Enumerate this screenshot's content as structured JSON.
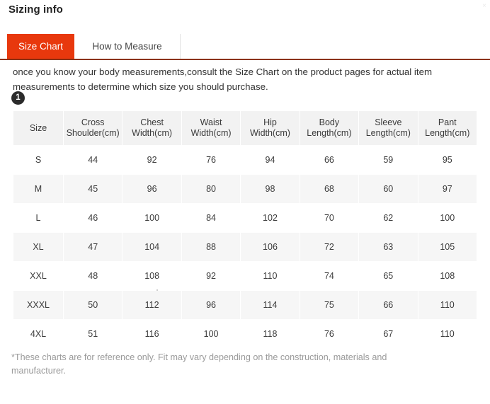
{
  "panel": {
    "title": "Sizing info",
    "close_icon_glyph": "×"
  },
  "tabs": [
    {
      "label": "Size Chart",
      "active": true
    },
    {
      "label": "How to Measure",
      "active": false
    }
  ],
  "intro": {
    "text": "once you know your body measurements,consult the Size Chart on the product pages for actual item measurements to determine which size you should purchase."
  },
  "step_badge": {
    "number": "1"
  },
  "chart_data": {
    "type": "table",
    "title": "Size Chart",
    "columns": [
      "Size",
      "Cross Shoulder(cm)",
      "Chest Width(cm)",
      "Waist Width(cm)",
      "Hip Width(cm)",
      "Body Length(cm)",
      "Sleeve Length(cm)",
      "Pant Length(cm)"
    ],
    "column_lines": [
      [
        "Size",
        ""
      ],
      [
        "Cross",
        "Shoulder(cm)"
      ],
      [
        "Chest",
        "Width(cm)"
      ],
      [
        "Waist",
        "Width(cm)"
      ],
      [
        "Hip",
        "Width(cm)"
      ],
      [
        "Body",
        "Length(cm)"
      ],
      [
        "Sleeve",
        "Length(cm)"
      ],
      [
        "Pant",
        "Length(cm)"
      ]
    ],
    "rows": [
      [
        "S",
        "44",
        "92",
        "76",
        "94",
        "66",
        "59",
        "95"
      ],
      [
        "M",
        "45",
        "96",
        "80",
        "98",
        "68",
        "60",
        "97"
      ],
      [
        "L",
        "46",
        "100",
        "84",
        "102",
        "70",
        "62",
        "100"
      ],
      [
        "XL",
        "47",
        "104",
        "88",
        "106",
        "72",
        "63",
        "105"
      ],
      [
        "XXL",
        "48",
        "108",
        "92",
        "110",
        "74",
        "65",
        "108"
      ],
      [
        "XXXL",
        "50",
        "112",
        "96",
        "114",
        "75",
        "66",
        "110"
      ],
      [
        "4XL",
        "51",
        "116",
        "100",
        "118",
        "76",
        "67",
        "110"
      ]
    ]
  },
  "footnote": {
    "text": "*These charts are for reference only. Fit may vary depending on the construction, materials and manufacturer."
  },
  "colors": {
    "tab_active_bg": "#e8380d",
    "tab_rule": "#8c3317",
    "header_bg": "#f2f2f2",
    "row_alt_bg": "#f6f6f6",
    "badge_bg": "#2b2b2b",
    "footnote_text": "#9a9a9a"
  }
}
